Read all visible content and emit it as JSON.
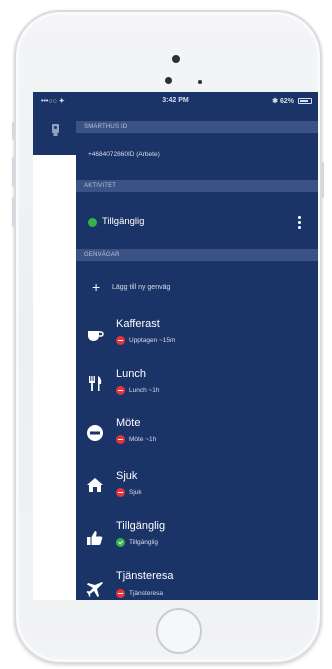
{
  "status_bar": {
    "carrier": "•••○○ ✦",
    "time": "3:42 PM",
    "battery": "✱ 62%"
  },
  "header": {
    "section_label": "Smarthus ID",
    "phone_number": "+4684072860ID (Arbete)"
  },
  "activity": {
    "section_label": "Aktivitet",
    "status_label": "Tillgänglig",
    "menu_icon": "more-vertical-icon"
  },
  "shortcuts": {
    "section_label": "Genvägar",
    "add_label": "Lägg till ny genväg",
    "items": [
      {
        "title": "Kafferast",
        "subtitle": "Upptagen ~15m",
        "icon": "coffee-icon",
        "badge": "red"
      },
      {
        "title": "Lunch",
        "subtitle": "Lunch ~1h",
        "icon": "cutlery-icon",
        "badge": "red"
      },
      {
        "title": "Möte",
        "subtitle": "Möte ~1h",
        "icon": "no-entry-icon",
        "badge": "red"
      },
      {
        "title": "Sjuk",
        "subtitle": "Sjuk",
        "icon": "home-icon",
        "badge": "red"
      },
      {
        "title": "Tillgänglig",
        "subtitle": "Tillgänglig",
        "icon": "thumbs-up-icon",
        "badge": "green"
      },
      {
        "title": "Tjänsteresa",
        "subtitle": "Tjänsteresa",
        "icon": "airplane-icon",
        "badge": "red"
      }
    ]
  },
  "colors": {
    "panel": "#1b3467",
    "band": "#3b5284",
    "available": "#35b24a",
    "busy": "#e6323c"
  }
}
